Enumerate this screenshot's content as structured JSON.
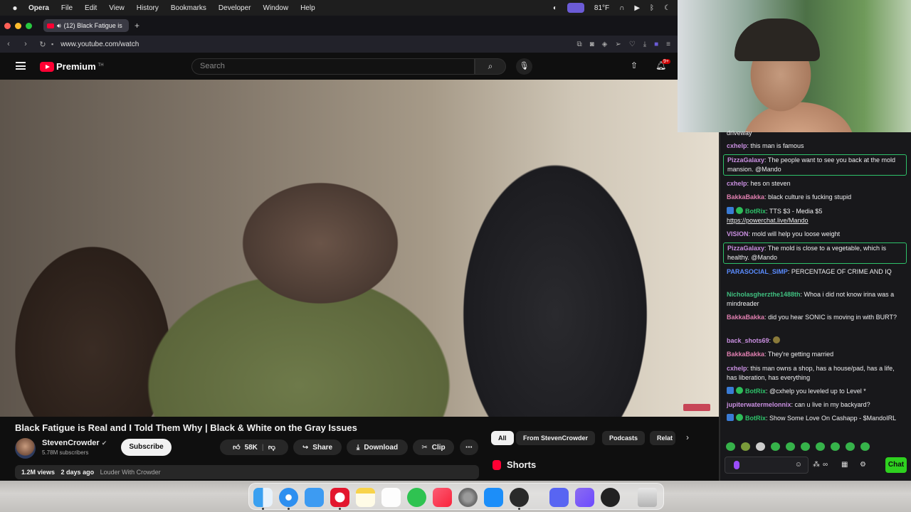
{
  "menubar": {
    "app": "Opera",
    "items": [
      "File",
      "Edit",
      "View",
      "History",
      "Bookmarks",
      "Developer",
      "Window",
      "Help"
    ],
    "temperature": "81°F"
  },
  "browser": {
    "tab_title": "(12) Black Fatigue is",
    "url": "www.youtube.com/watch"
  },
  "youtube": {
    "brand": "Premium",
    "brand_sup": "TH",
    "search_placeholder": "Search",
    "notif_badge": "9+",
    "video": {
      "title": "Black Fatigue is Real and I Told Them Why | Black & White on the Gray Issues",
      "channel": "StevenCrowder",
      "subscribers": "5.78M subscribers",
      "subscribe_label": "Subscribe",
      "likes": "58K",
      "share_label": "Share",
      "download_label": "Download",
      "clip_label": "Clip",
      "views": "1.2M views",
      "age": "2 days ago",
      "tag": "Louder With Crowder"
    },
    "chips": [
      "All",
      "From StevenCrowder",
      "Podcasts",
      "Relat"
    ],
    "shorts_label": "Shorts"
  },
  "chat": {
    "messages": [
      {
        "user": "",
        "text": "driveway",
        "color": "#efeff1"
      },
      {
        "user": "cxhelp",
        "text": "this man is famous",
        "color": "#c98fe0"
      },
      {
        "user": "PizzaGalaxy",
        "text": "The people want to see you back at the mold mansion. @Mando",
        "color": "#c98fe0",
        "highlight": true
      },
      {
        "user": "cxhelp",
        "text": "hes on steven",
        "color": "#c98fe0"
      },
      {
        "user": "BakkaBakka",
        "text": "black culture is fucking stupid",
        "color": "#e07fb0"
      },
      {
        "user": "BotRix",
        "text": "TTS $3 - Media $5",
        "link": "https://powerchat.live/Mando",
        "color": "#2ec26a",
        "badges": true
      },
      {
        "user": "VISION",
        "text": "mold will help you loose weight",
        "color": "#c98fe0"
      },
      {
        "user": "PizzaGalaxy",
        "text": "The mold is close to a vegetable, which is healthy. @Mando",
        "color": "#c98fe0",
        "highlight": true
      },
      {
        "user": "PARASOCIAL_SIMP",
        "text": "PERCENTAGE OF CRIME AND IQ",
        "color": "#5a8cff"
      },
      {
        "user": "Nicholasgherzthe1488th",
        "text": "Whoa i did not know irina was a mindreader",
        "color": "#40c080"
      },
      {
        "user": "BakkaBakka",
        "text": "did you hear SONIC is moving in with BURT?",
        "color": "#e07fb0"
      },
      {
        "user": "back_shots69",
        "text": "",
        "color": "#c98fe0"
      },
      {
        "user": "BakkaBakka",
        "text": "They're getting married",
        "color": "#e07fb0"
      },
      {
        "user": "cxhelp",
        "text": "this man owns a shop, has a house/pad, has a life, has liberation, has everything",
        "color": "#c98fe0"
      },
      {
        "user": "BotRix",
        "text": "@cxhelp you leveled up to Level *",
        "color": "#2ec26a",
        "badges": true
      },
      {
        "user": "jupiterwatermelonnix",
        "text": "can u live in my backyard?",
        "color": "#c98fe0"
      },
      {
        "user": "BotRix",
        "text": "Show Some Love On Cashapp - $MandoIRL",
        "color": "#2ec26a",
        "badges": true
      }
    ],
    "send_label": "Chat"
  },
  "dock": {
    "apps": [
      "Finder",
      "Safari",
      "Mail",
      "Opera",
      "Notes",
      "Reminders",
      "WhatsApp",
      "Music",
      "System Settings",
      "App Store",
      "OBS",
      "Discord",
      "Proton Mail",
      "OBS Studio",
      "Trash"
    ]
  }
}
